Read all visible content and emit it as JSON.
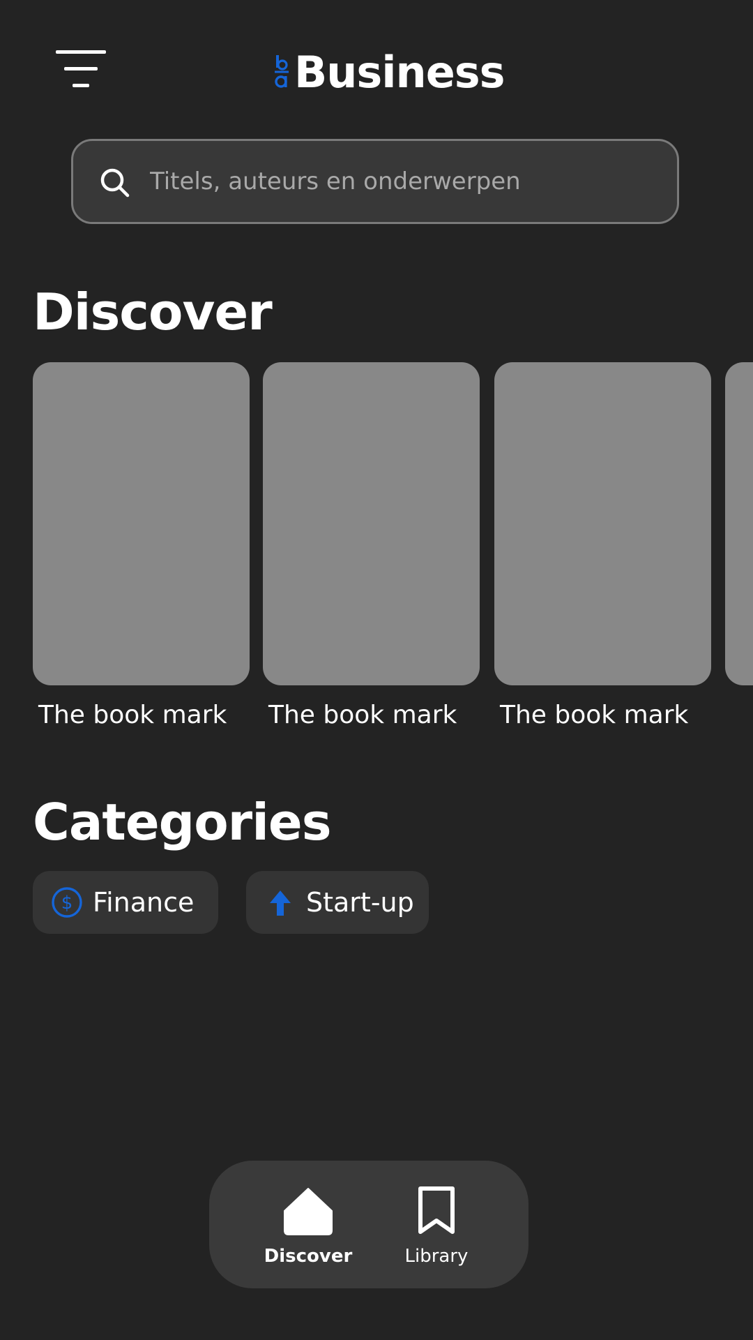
{
  "header": {
    "title": "Business",
    "menu_icon": "menu-icon",
    "logo_icon": "brand-logo-icon",
    "accent_color": "#1565d8"
  },
  "search": {
    "placeholder": "Titels, auteurs en onderwerpen",
    "value": "",
    "icon": "search-icon"
  },
  "discover": {
    "title": "Discover",
    "books": [
      {
        "title": "The book mark"
      },
      {
        "title": "The book mark"
      },
      {
        "title": "The book mark"
      },
      {
        "title": ""
      }
    ]
  },
  "categories": {
    "title": "Categories",
    "items": [
      {
        "label": "Finance",
        "icon": "dollar-circle-icon"
      },
      {
        "label": "Start-up",
        "icon": "arrow-up-icon"
      }
    ]
  },
  "bottom_nav": {
    "items": [
      {
        "label": "Discover",
        "icon": "home-icon",
        "active": true
      },
      {
        "label": "Library",
        "icon": "bookmark-icon",
        "active": false
      }
    ]
  },
  "colors": {
    "background": "#232323",
    "surface": "#383838",
    "cover_placeholder": "#888888",
    "accent": "#1565d8"
  }
}
